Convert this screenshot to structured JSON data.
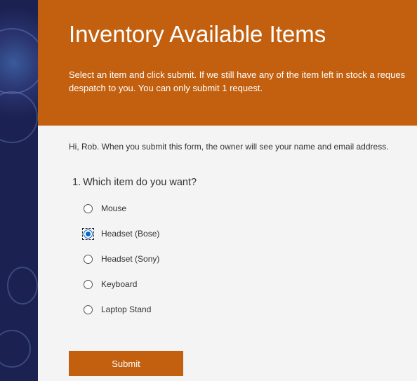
{
  "form": {
    "title": "Inventory Available Items",
    "description": "Select an item and click submit. If we still have any of the item left in stock a reques\ndespatch to you. You can only submit 1 request.",
    "intro": "Hi, Rob. When you submit this form, the owner will see your name and email address.",
    "question": {
      "number": "1.",
      "text": "Which item do you want?",
      "options": [
        {
          "label": "Mouse",
          "selected": false
        },
        {
          "label": "Headset (Bose)",
          "selected": true
        },
        {
          "label": "Headset (Sony)",
          "selected": false
        },
        {
          "label": "Keyboard",
          "selected": false
        },
        {
          "label": "Laptop Stand",
          "selected": false
        }
      ]
    },
    "submit_label": "Submit"
  },
  "colors": {
    "accent": "#c2600f",
    "radio_selected": "#0a67c8",
    "panel_background": "#f4f4f4"
  }
}
